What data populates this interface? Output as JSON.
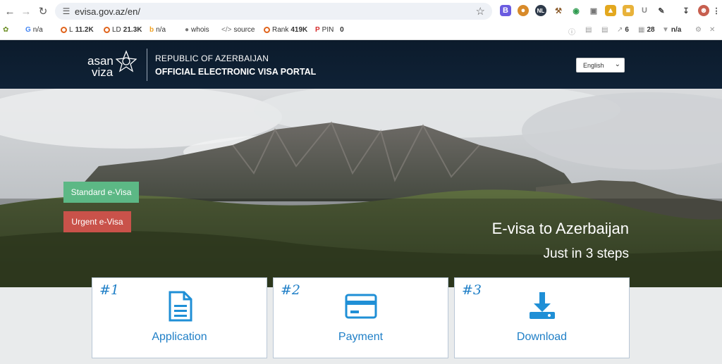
{
  "browser": {
    "url": "evisa.gov.az/en/"
  },
  "seo_bar": {
    "google": "n/a",
    "links": "L",
    "links_value": "11.2K",
    "linking_domains": "LD",
    "linking_domains_value": "21.3K",
    "bing": "n/a",
    "whois": "whois",
    "source": "source",
    "rank": "Rank",
    "rank_value": "419K",
    "pin": "PIN",
    "pin_value": "0",
    "right_a": "6",
    "right_b": "28",
    "right_c": "n/a"
  },
  "header": {
    "logo_top": "asan",
    "logo_bottom": "viza",
    "line1": "REPUBLIC OF AZERBAIJAN",
    "line2": "OFFICIAL ELECTRONIC VISA PORTAL",
    "language": "English"
  },
  "hero": {
    "standard_button": "Standard e-Visa",
    "urgent_button": "Urgent e-Visa",
    "title": "E-visa to Azerbaijan",
    "subtitle": "Just in 3 steps"
  },
  "steps": [
    {
      "number": "#1",
      "label": "Application",
      "icon": "document-icon"
    },
    {
      "number": "#2",
      "label": "Payment",
      "icon": "credit-card-icon"
    },
    {
      "number": "#3",
      "label": "Download",
      "icon": "download-icon"
    }
  ],
  "colors": {
    "header_bg": "#0c1b2c",
    "standard_button": "#5cb885",
    "urgent_button": "#c9524a",
    "accent_blue": "#1f7fc7"
  }
}
